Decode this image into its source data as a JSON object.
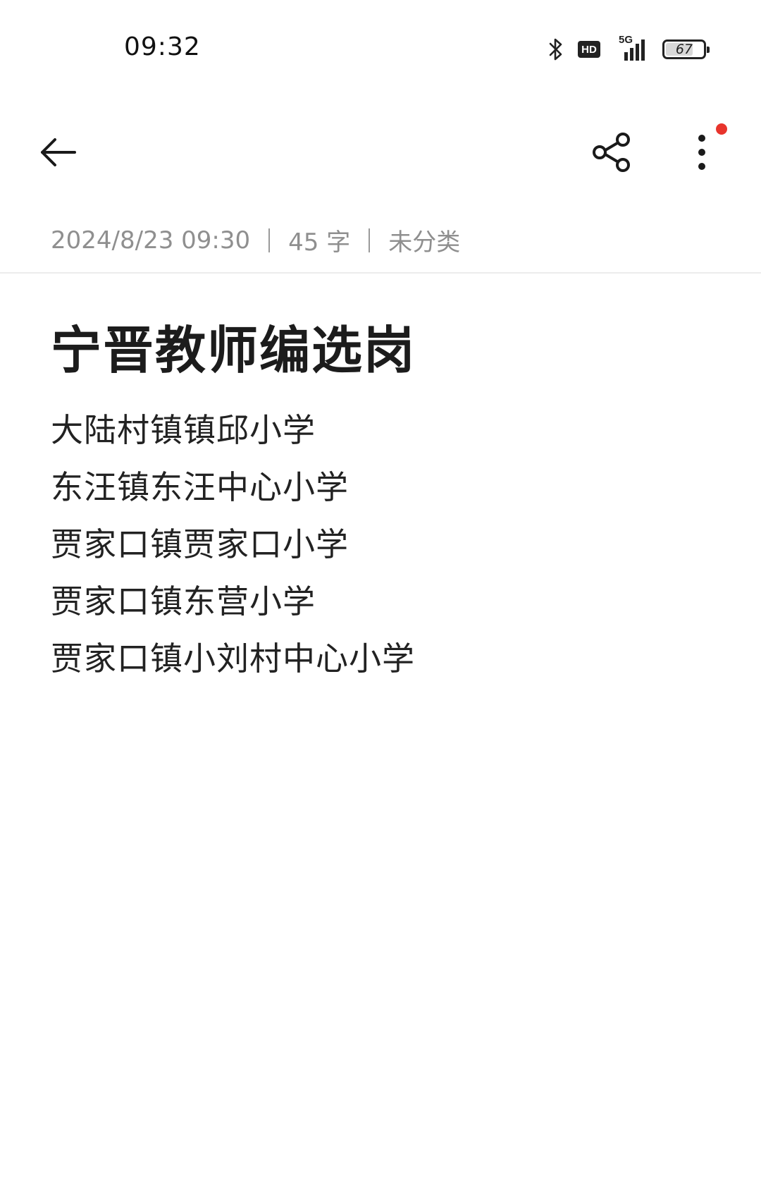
{
  "status_bar": {
    "time": "09:32",
    "battery_percent": "67",
    "network_label": "5G",
    "hd_label": "HD",
    "icons": [
      "bluetooth-icon",
      "hd-icon",
      "5g-signal-icon",
      "battery-icon"
    ]
  },
  "app_bar": {
    "back_icon": "arrow-left-icon",
    "share_icon": "share-icon",
    "more_icon": "more-vertical-icon",
    "notification_dot_color": "#e8342c"
  },
  "note": {
    "meta": {
      "datetime": "2024/8/23 09:30",
      "word_count": "45 字",
      "category": "未分类"
    },
    "title": "宁晋教师编选岗",
    "lines": [
      "大陆村镇镇邱小学",
      "东汪镇东汪中心小学",
      "贾家口镇贾家口小学",
      "贾家口镇东营小学",
      "贾家口镇小刘村中心小学"
    ]
  }
}
